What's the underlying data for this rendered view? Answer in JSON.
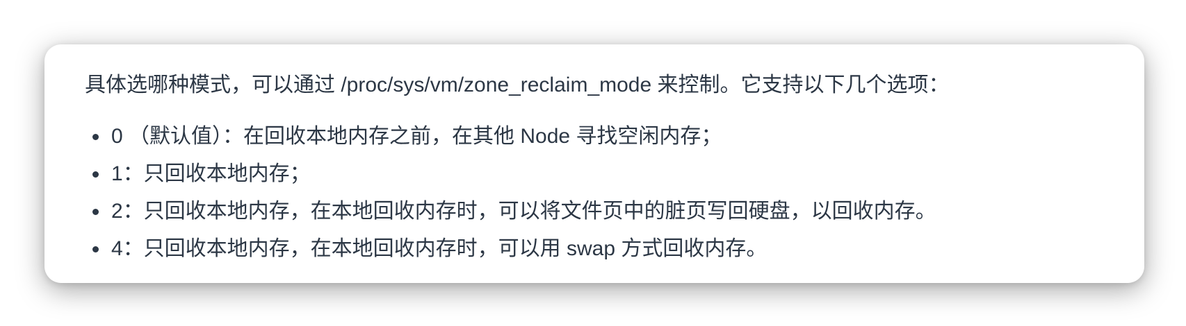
{
  "intro": "具体选哪种模式，可以通过 /proc/sys/vm/zone_reclaim_mode 来控制。它支持以下几个选项：",
  "options": [
    {
      "text": "0 （默认值）：在回收本地内存之前，在其他 Node 寻找空闲内存；"
    },
    {
      "text": "1：只回收本地内存；"
    },
    {
      "text": "2：只回收本地内存，在本地回收内存时，可以将文件页中的脏页写回硬盘，以回收内存。"
    },
    {
      "text": "4：只回收本地内存，在本地回收内存时，可以用 swap 方式回收内存。"
    }
  ],
  "colors": {
    "text": "#2c3745",
    "card_background": "#ffffff"
  }
}
